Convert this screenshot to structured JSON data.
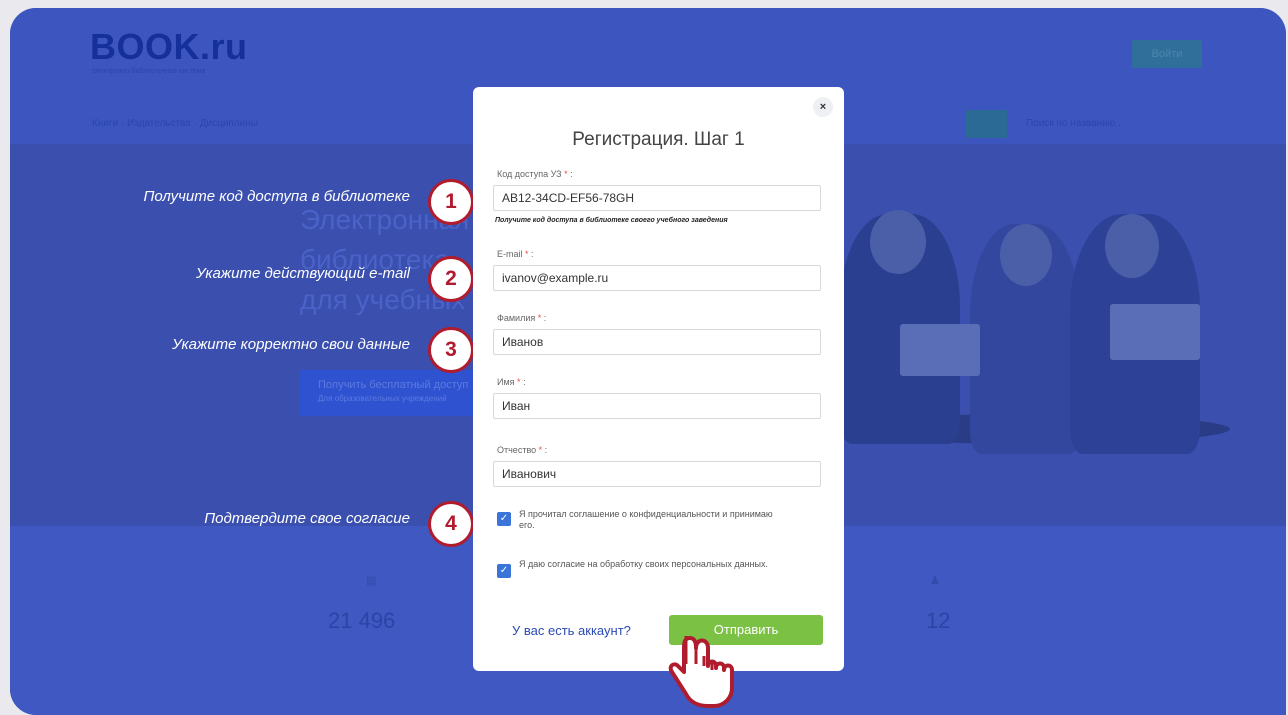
{
  "site": {
    "logo": "BOOK.ru",
    "logo_sub": "электронно-библиотечная система",
    "login_label": "Войти",
    "nav_text": "Книги · Издательства · Дисциплины",
    "search_placeholder": "Поиск по названию...",
    "hero_lines": [
      "Электронная",
      "библиотека",
      "для учебных"
    ],
    "hero_button": "Получить бесплатный доступ",
    "hero_button_sub": "Для образовательных учреждений"
  },
  "stats": [
    {
      "icon": "book-icon",
      "value": "21 496"
    },
    {
      "icon": "users-icon",
      "value": "12"
    }
  ],
  "callouts": [
    {
      "number": "1",
      "text": "Получите код доступа в библиотеке"
    },
    {
      "number": "2",
      "text": "Укажите действующий e-mail"
    },
    {
      "number": "3",
      "text": "Укажите корректно свои данные"
    },
    {
      "number": "4",
      "text": "Подтвердите свое согласие"
    }
  ],
  "modal": {
    "close": "×",
    "title": "Регистрация. Шаг 1",
    "fields": [
      {
        "label": "Код доступа УЗ",
        "value": "AB12-34CD-EF56-78GH"
      },
      {
        "label": "E-mail",
        "value": "ivanov@example.ru"
      },
      {
        "label": "Фамилия",
        "value": "Иванов"
      },
      {
        "label": "Имя",
        "value": "Иван"
      },
      {
        "label": "Отчество",
        "value": "Иванович"
      }
    ],
    "required_mark": "*",
    "access_hint": "Получите код доступа в библиотеке своего учебного заведения",
    "consents": [
      {
        "text": "Я прочитал соглашение о конфиденциальности и принимаю его.",
        "checked": true
      },
      {
        "text": "Я даю согласие на обработку своих персональных данных.",
        "checked": true
      }
    ],
    "account_link": "У вас есть аккаунт?",
    "submit": "Отправить"
  },
  "colors": {
    "overlay": "#3f58c2",
    "callout_red": "#b01c2e",
    "submit_green": "#7ac144",
    "checkbox_blue": "#3a74d8"
  }
}
